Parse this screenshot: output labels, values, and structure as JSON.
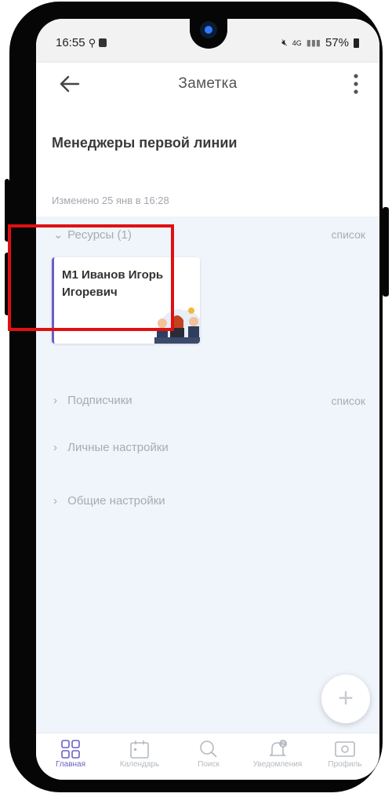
{
  "status_bar": {
    "time": "16:55",
    "network": "4G",
    "battery": "57%"
  },
  "app_bar": {
    "title": "Заметка"
  },
  "note": {
    "title": "Менеджеры первой линии",
    "changed": "Изменено 25 янв в 16:28"
  },
  "sections": [
    {
      "label": "Ресурсы (1)",
      "right": "список",
      "expanded": true
    },
    {
      "label": "Подписчики",
      "right": "список",
      "expanded": false
    },
    {
      "label": "Личные настройки",
      "right": "",
      "expanded": false
    },
    {
      "label": "Общие настройки",
      "right": "",
      "expanded": false
    }
  ],
  "resource_card": {
    "title": "М1 Иванов Игорь Игоревич"
  },
  "fab": {
    "symbol": "+"
  },
  "bottom_nav": [
    {
      "label": "Главная",
      "icon": "home-grid-icon",
      "active": true
    },
    {
      "label": "Календарь",
      "icon": "calendar-icon",
      "active": false
    },
    {
      "label": "Поиск",
      "icon": "search-icon",
      "active": false
    },
    {
      "label": "Уведомления",
      "icon": "bell-icon",
      "active": false,
      "badge": "2"
    },
    {
      "label": "Профиль",
      "icon": "profile-card-icon",
      "active": false
    }
  ],
  "colors": {
    "accent": "#6a5fc7",
    "highlight": "#e01010",
    "background": "#f0f4fb"
  }
}
